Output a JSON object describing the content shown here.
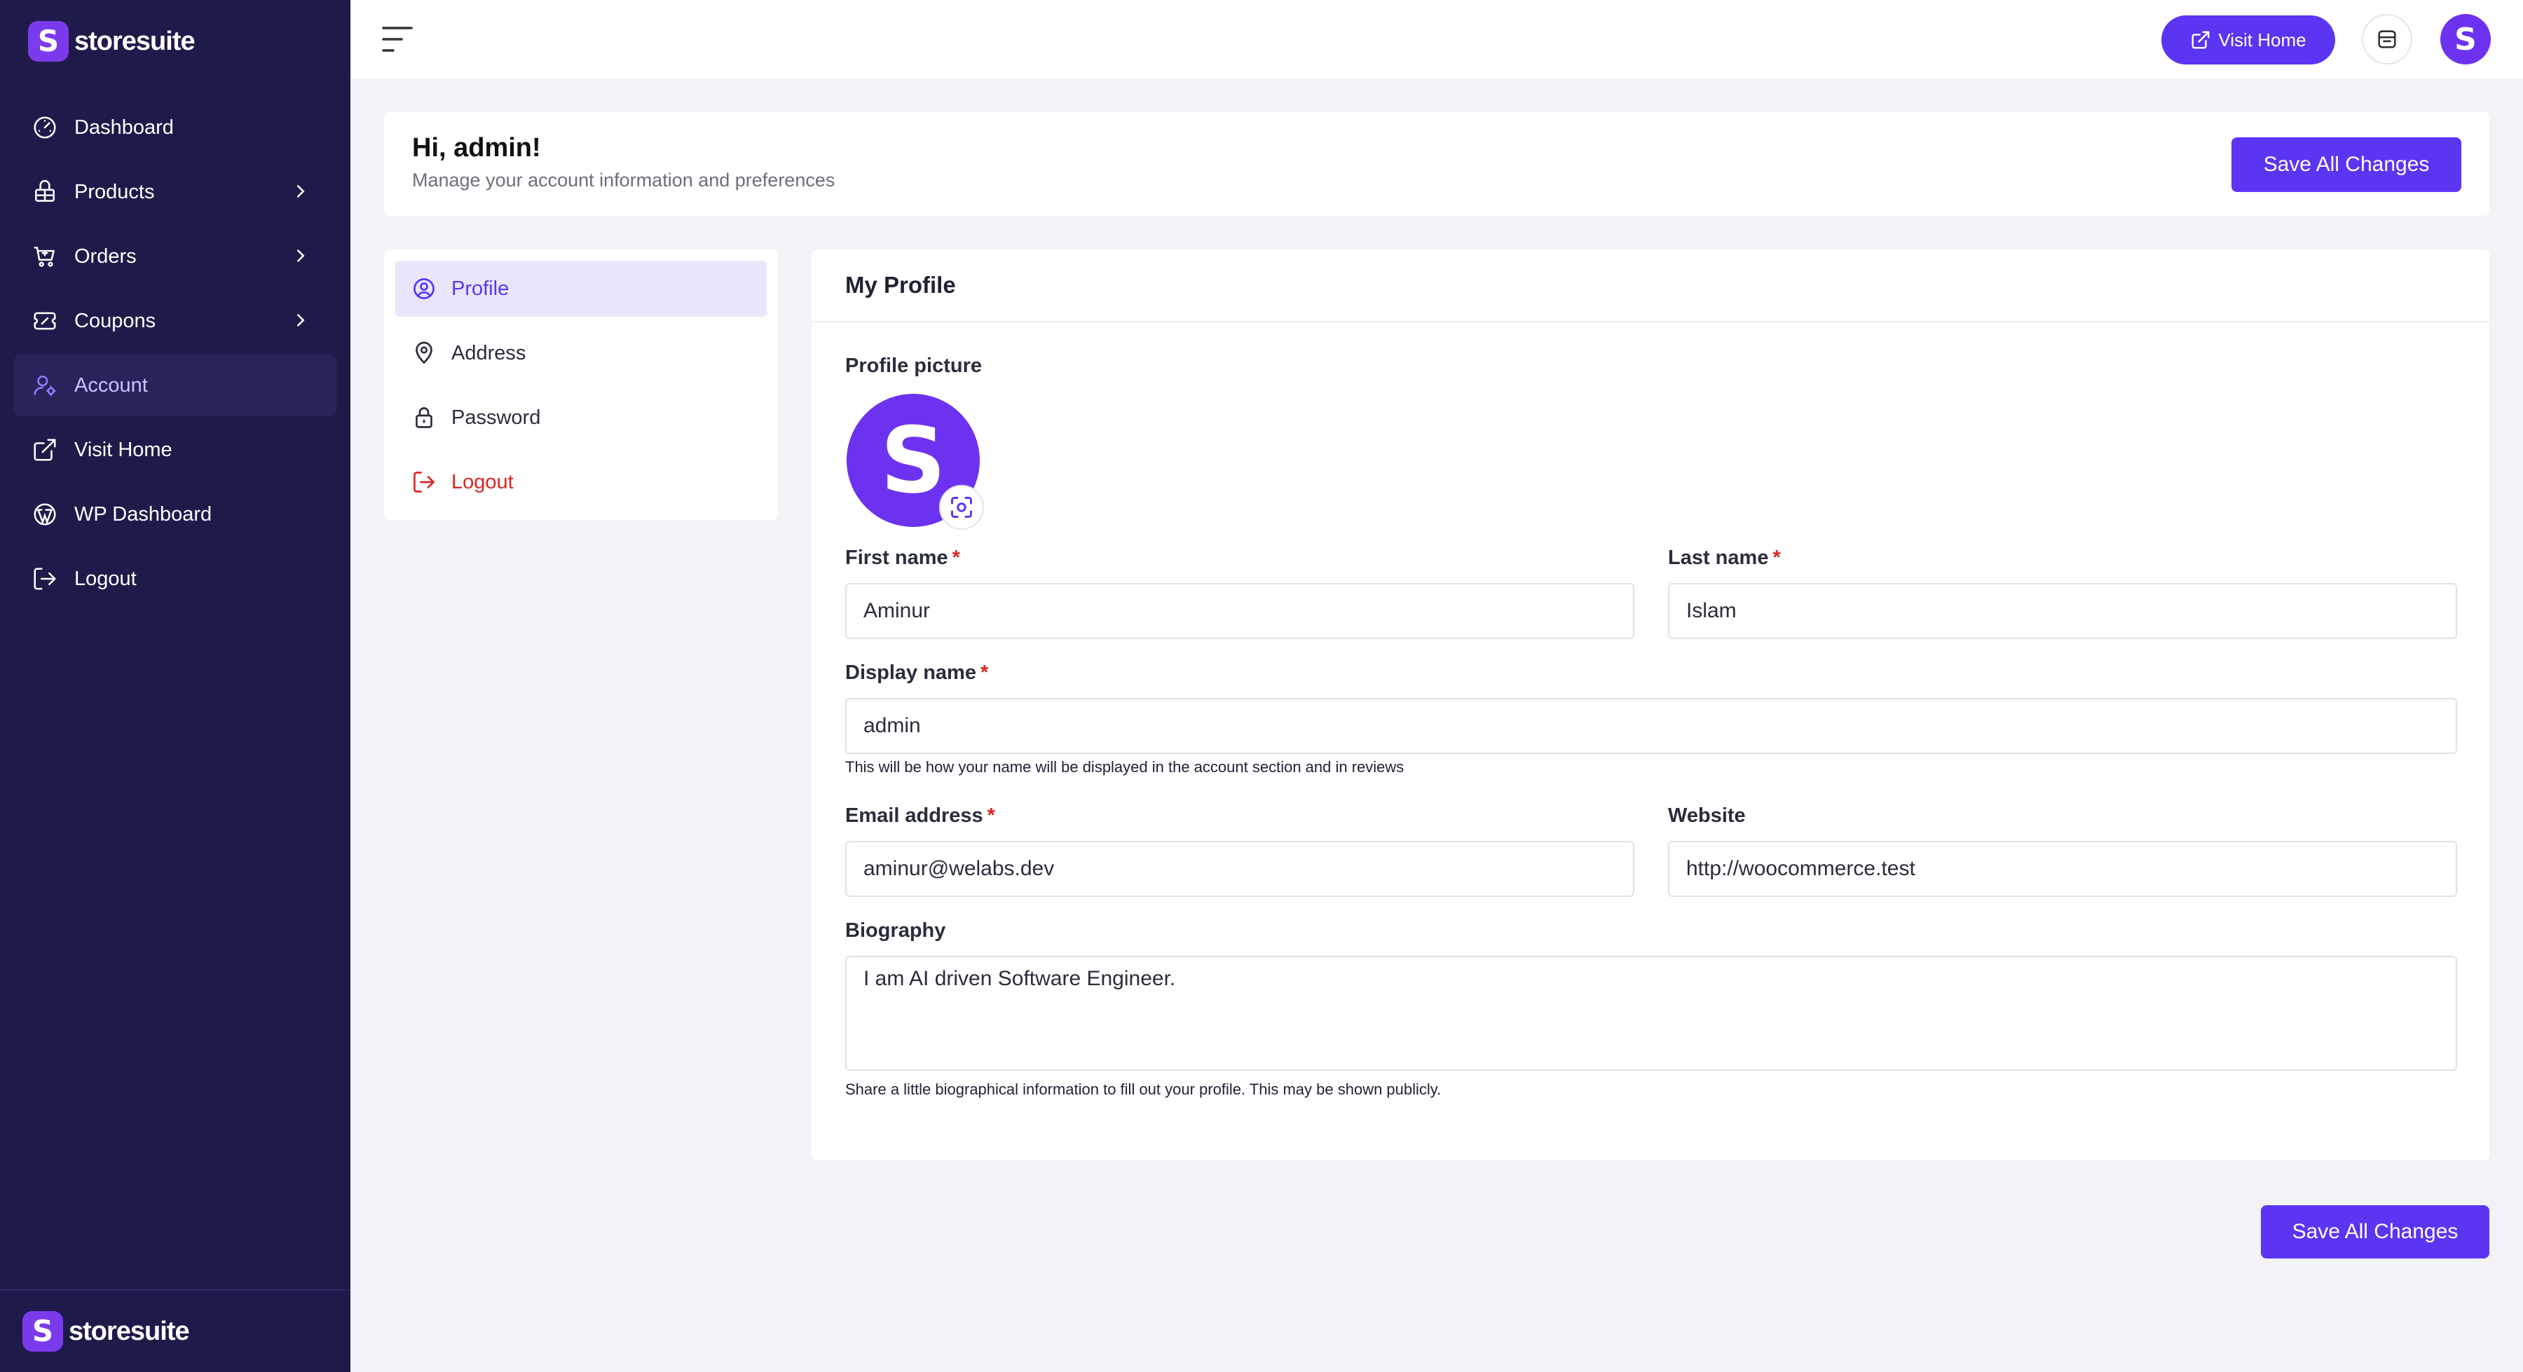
{
  "brand": {
    "name": "storesuite",
    "logo_letter": "S"
  },
  "sidebar": {
    "items": [
      {
        "label": "Dashboard",
        "icon": "gauge-icon",
        "has_children": false,
        "active": false
      },
      {
        "label": "Products",
        "icon": "package-icon",
        "has_children": true,
        "active": false
      },
      {
        "label": "Orders",
        "icon": "cart-icon",
        "has_children": true,
        "active": false
      },
      {
        "label": "Coupons",
        "icon": "ticket-icon",
        "has_children": true,
        "active": false
      },
      {
        "label": "Account",
        "icon": "user-cog-icon",
        "has_children": false,
        "active": true
      },
      {
        "label": "Visit Home",
        "icon": "external-link-icon",
        "has_children": false,
        "active": false
      },
      {
        "label": "WP Dashboard",
        "icon": "wordpress-icon",
        "has_children": false,
        "active": false
      },
      {
        "label": "Logout",
        "icon": "logout-icon",
        "has_children": false,
        "active": false
      }
    ]
  },
  "topbar": {
    "visit_home_label": "Visit Home",
    "avatar_letter": "S"
  },
  "header": {
    "greeting": "Hi, admin!",
    "subtitle": "Manage your account information and preferences",
    "save_label": "Save All Changes"
  },
  "account_menu": {
    "items": [
      {
        "label": "Profile",
        "icon": "user-circle-icon",
        "active": true
      },
      {
        "label": "Address",
        "icon": "map-pin-icon",
        "active": false
      },
      {
        "label": "Password",
        "icon": "lock-icon",
        "active": false
      },
      {
        "label": "Logout",
        "icon": "logout-icon",
        "active": false
      }
    ]
  },
  "profile": {
    "title": "My Profile",
    "picture_label": "Profile picture",
    "picture_letter": "S",
    "required_marker": "*",
    "first_name": {
      "label": "First name",
      "value": "Aminur"
    },
    "last_name": {
      "label": "Last name",
      "value": "Islam"
    },
    "display_name": {
      "label": "Display name",
      "value": "admin",
      "help": "This will be how your name will be displayed in the account section and in reviews"
    },
    "email": {
      "label": "Email address",
      "value": "aminur@welabs.dev"
    },
    "website": {
      "label": "Website",
      "value": "http://woocommerce.test"
    },
    "biography": {
      "label": "Biography",
      "value": "I am AI driven Software Engineer.",
      "help": "Share a little biographical information to fill out your profile. This may be shown publicly."
    }
  },
  "footer": {
    "save_label": "Save All Changes"
  },
  "colors": {
    "sidebar_bg": "#1e1b4b",
    "accent": "#5b35f2",
    "danger": "#dc2626",
    "page_bg": "#f1f3f6"
  }
}
